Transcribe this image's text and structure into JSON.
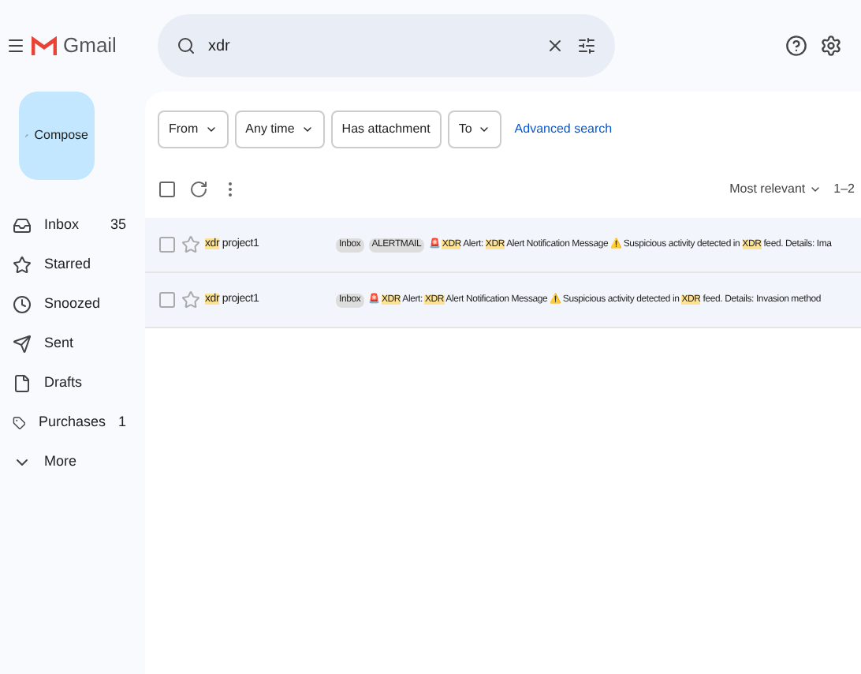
{
  "app": {
    "name": "Gmail"
  },
  "search": {
    "value": "xdr"
  },
  "compose": {
    "label": "Compose"
  },
  "sidebar": {
    "items": [
      {
        "label": "Inbox",
        "count": "35",
        "kind": "inbox"
      },
      {
        "label": "Starred",
        "kind": "star"
      },
      {
        "label": "Snoozed",
        "kind": "clock"
      },
      {
        "label": "Sent",
        "kind": "send"
      },
      {
        "label": "Drafts",
        "kind": "file"
      },
      {
        "label": "Purchases",
        "count": "1",
        "kind": "tag"
      },
      {
        "label": "More",
        "kind": "chevron"
      }
    ]
  },
  "filters": [
    {
      "label": "From",
      "dropdown": true
    },
    {
      "label": "Any time",
      "dropdown": true
    },
    {
      "label": "Has attachment",
      "dropdown": false
    },
    {
      "label": "To",
      "dropdown": true
    }
  ],
  "advanced_search": "Advanced search",
  "toolbar": {
    "sort": "Most relevant",
    "range": "1–2"
  },
  "messages": [
    {
      "sender": [
        {
          "text": "xdr",
          "kind": "match"
        },
        {
          "text": " project1",
          "kind": "text"
        }
      ],
      "label": "Inbox",
      "tag": "ALERTMAIL",
      "snippet": [
        {
          "text": "🚨 ",
          "kind": "text"
        },
        {
          "text": "XDR",
          "kind": "match"
        },
        {
          "text": " Alert: ",
          "kind": "text"
        },
        {
          "text": "XDR",
          "kind": "match"
        },
        {
          "text": " Alert Notification Message ⚠️ Suspicious activity detected in ",
          "kind": "text"
        },
        {
          "text": "XDR",
          "kind": "match"
        },
        {
          "text": " feed. Details: Ima",
          "kind": "text"
        }
      ]
    },
    {
      "sender": [
        {
          "text": "xdr",
          "kind": "match"
        },
        {
          "text": " project1",
          "kind": "text"
        }
      ],
      "label": "Inbox",
      "snippet": [
        {
          "text": "🚨 ",
          "kind": "text"
        },
        {
          "text": "XDR",
          "kind": "match"
        },
        {
          "text": " Alert: ",
          "kind": "text"
        },
        {
          "text": "XDR",
          "kind": "match"
        },
        {
          "text": " Alert Notification Message ⚠️ Suspicious activity detected in ",
          "kind": "text"
        },
        {
          "text": "XDR",
          "kind": "match"
        },
        {
          "text": " feed. Details: Invasion method",
          "kind": "text"
        }
      ]
    }
  ]
}
